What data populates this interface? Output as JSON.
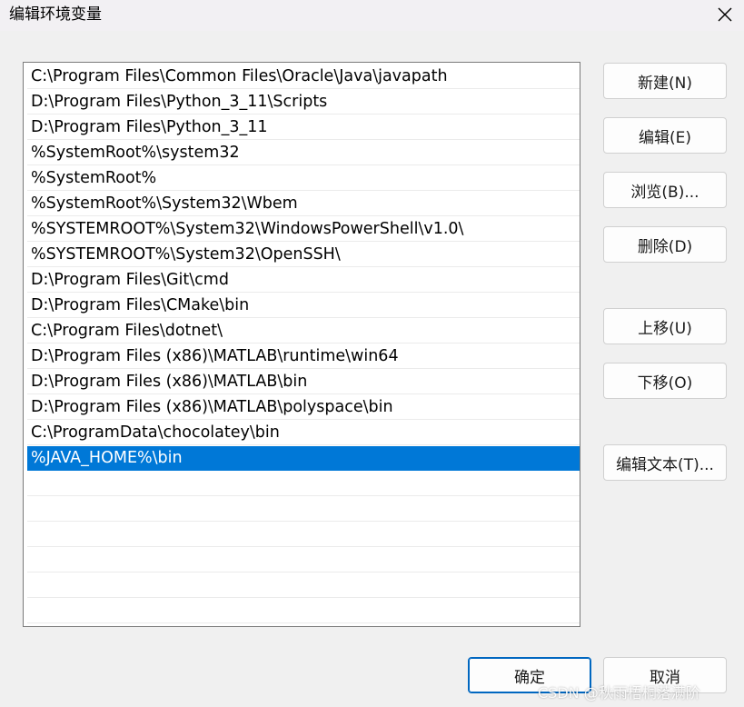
{
  "window": {
    "title": "编辑环境变量"
  },
  "path_list": {
    "items": [
      "C:\\Program Files\\Common Files\\Oracle\\Java\\javapath",
      "D:\\Program Files\\Python_3_11\\Scripts",
      "D:\\Program Files\\Python_3_11",
      "%SystemRoot%\\system32",
      "%SystemRoot%",
      "%SystemRoot%\\System32\\Wbem",
      "%SYSTEMROOT%\\System32\\WindowsPowerShell\\v1.0\\",
      "%SYSTEMROOT%\\System32\\OpenSSH\\",
      "D:\\Program Files\\Git\\cmd",
      "D:\\Program Files\\CMake\\bin",
      "C:\\Program Files\\dotnet\\",
      "D:\\Program Files (x86)\\MATLAB\\runtime\\win64",
      "D:\\Program Files (x86)\\MATLAB\\bin",
      "D:\\Program Files (x86)\\MATLAB\\polyspace\\bin",
      "C:\\ProgramData\\chocolatey\\bin",
      "%JAVA_HOME%\\bin"
    ],
    "selected_index": 15
  },
  "side_buttons": {
    "new": "新建(N)",
    "edit": "编辑(E)",
    "browse": "浏览(B)...",
    "delete": "删除(D)",
    "move_up": "上移(U)",
    "move_down": "下移(O)",
    "edit_text": "编辑文本(T)..."
  },
  "footer": {
    "ok": "确定",
    "cancel": "取消"
  },
  "watermark": "CSDN @秋雨梧桐落满阶",
  "colors": {
    "selection": "#0078d7",
    "primary_border": "#0067c0"
  },
  "icons": {
    "close": "close-icon"
  }
}
